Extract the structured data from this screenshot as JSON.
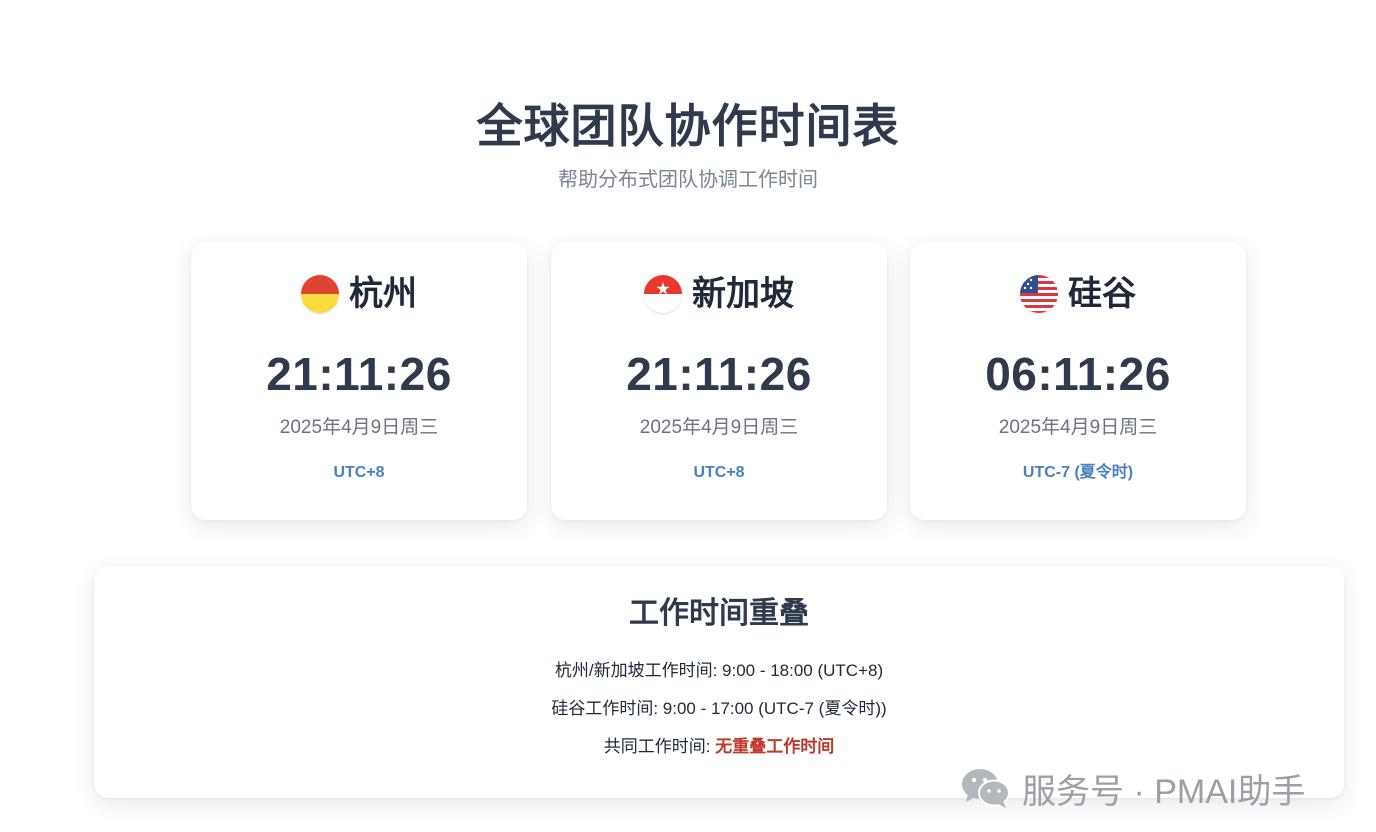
{
  "header": {
    "title": "全球团队协作时间表",
    "subtitle": "帮助分布式团队协调工作时间"
  },
  "clocks": [
    {
      "city": "杭州",
      "flag_icon": "china-flag-icon",
      "time": "21:11:26",
      "date": "2025年4月9日周三",
      "utc": "UTC+8"
    },
    {
      "city": "新加坡",
      "flag_icon": "singapore-flag-icon",
      "time": "21:11:26",
      "date": "2025年4月9日周三",
      "utc": "UTC+8"
    },
    {
      "city": "硅谷",
      "flag_icon": "usa-flag-icon",
      "time": "06:11:26",
      "date": "2025年4月9日周三",
      "utc": "UTC-7 (夏令时)"
    }
  ],
  "overlap": {
    "title": "工作时间重叠",
    "line1": "杭州/新加坡工作时间: 9:00 - 18:00 (UTC+8)",
    "line2": "硅谷工作时间: 9:00 - 17:00 (UTC-7 (夏令时))",
    "line3_label": "共同工作时间: ",
    "line3_value": "无重叠工作时间"
  },
  "watermark": {
    "icon": "wechat-icon",
    "text": "服务号 · PMAI助手"
  },
  "colors": {
    "title": "#2f3a4d",
    "utc_accent": "#4a7fc0",
    "highlight": "#c0392b",
    "subtitle": "#7b8594"
  }
}
